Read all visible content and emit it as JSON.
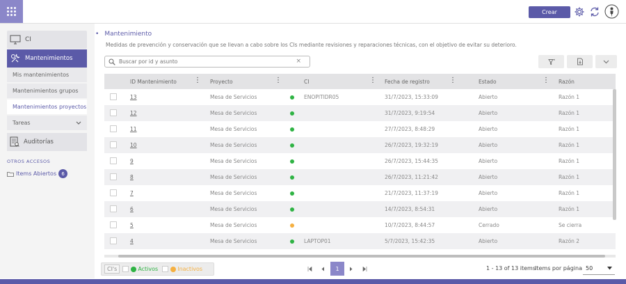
{
  "topbar": {
    "create_label": "Crear",
    "icons": [
      "apps-grid-icon",
      "gear-icon",
      "refresh-icon",
      "user-icon"
    ]
  },
  "sidebar": {
    "ci_label": "CI",
    "main_label": "Mantenimientos",
    "subitems": [
      "Mis mantenimientos",
      "Mantenimientos grupos",
      "Mantenimientos proyectos"
    ],
    "tareas_label": "Tareas",
    "auditorias_label": "Auditorías",
    "otros_label": "OTROS ACCESOS",
    "items_abiertos_label": "Items Abiertos",
    "items_abiertos_count": "6"
  },
  "page": {
    "title": "Mantenimiento",
    "description": "Medidas de prevención y conservación que se llevan a cabo sobre los CIs mediante revisiones y reparaciones técnicas, con el objetivo de evitar su deterioro."
  },
  "search": {
    "placeholder": "Buscar por id y asunto",
    "clear": "×"
  },
  "table": {
    "headers": [
      "ID Mantenimiento",
      "Proyecto",
      "CI",
      "Fecha de registro",
      "Estado",
      "Razón"
    ],
    "rows": [
      {
        "id": "13",
        "proyecto": "Mesa de Servicios",
        "status_color": "#2fb344",
        "ci": "ENOPITIDR05",
        "fecha": "31/7/2023, 15:33:09",
        "estado": "Abierto",
        "razon": "Razón 1"
      },
      {
        "id": "12",
        "proyecto": "Mesa de Servicios",
        "status_color": "#2fb344",
        "ci": "",
        "fecha": "31/7/2023, 9:19:54",
        "estado": "Abierto",
        "razon": "Razón 1"
      },
      {
        "id": "11",
        "proyecto": "Mesa de Servicios",
        "status_color": "#2fb344",
        "ci": "",
        "fecha": "27/7/2023, 8:48:29",
        "estado": "Abierto",
        "razon": "Razón 1"
      },
      {
        "id": "10",
        "proyecto": "Mesa de Servicios",
        "status_color": "#2fb344",
        "ci": "",
        "fecha": "26/7/2023, 19:32:19",
        "estado": "Abierto",
        "razon": "Razón 1"
      },
      {
        "id": "9",
        "proyecto": "Mesa de Servicios",
        "status_color": "#2fb344",
        "ci": "",
        "fecha": "26/7/2023, 15:44:35",
        "estado": "Abierto",
        "razon": "Razón 1"
      },
      {
        "id": "8",
        "proyecto": "Mesa de Servicios",
        "status_color": "#2fb344",
        "ci": "",
        "fecha": "26/7/2023, 11:21:42",
        "estado": "Abierto",
        "razon": "Razón 1"
      },
      {
        "id": "7",
        "proyecto": "Mesa de Servicios",
        "status_color": "#2fb344",
        "ci": "",
        "fecha": "21/7/2023, 11:37:19",
        "estado": "Abierto",
        "razon": "Razón 1"
      },
      {
        "id": "6",
        "proyecto": "Mesa de Servicios",
        "status_color": "#2fb344",
        "ci": "",
        "fecha": "14/7/2023, 8:54:31",
        "estado": "Abierto",
        "razon": "Razón 1"
      },
      {
        "id": "5",
        "proyecto": "Mesa de Servicios",
        "status_color": "#f5b041",
        "ci": "",
        "fecha": "10/7/2023, 8:44:57",
        "estado": "Cerrado",
        "razon": "Se cierra"
      },
      {
        "id": "4",
        "proyecto": "Mesa de Servicios",
        "status_color": "#2fb344",
        "ci": "LAPTOP01",
        "fecha": "5/7/2023, 15:42:35",
        "estado": "Abierto",
        "razon": "Razón 2"
      }
    ]
  },
  "legend": {
    "ci_label": "CI's",
    "active_label": "Activos",
    "inactive_label": "Inactivos",
    "active_color": "#2fb344",
    "inactive_color": "#f5b041"
  },
  "pagination": {
    "current_page": "1",
    "range": "1 - 13 of 13 items",
    "items_per_page_label": "Items por página",
    "items_per_page": "50"
  },
  "colors": {
    "primary": "#5b5aa8",
    "apps_bg": "#8b87c9"
  }
}
